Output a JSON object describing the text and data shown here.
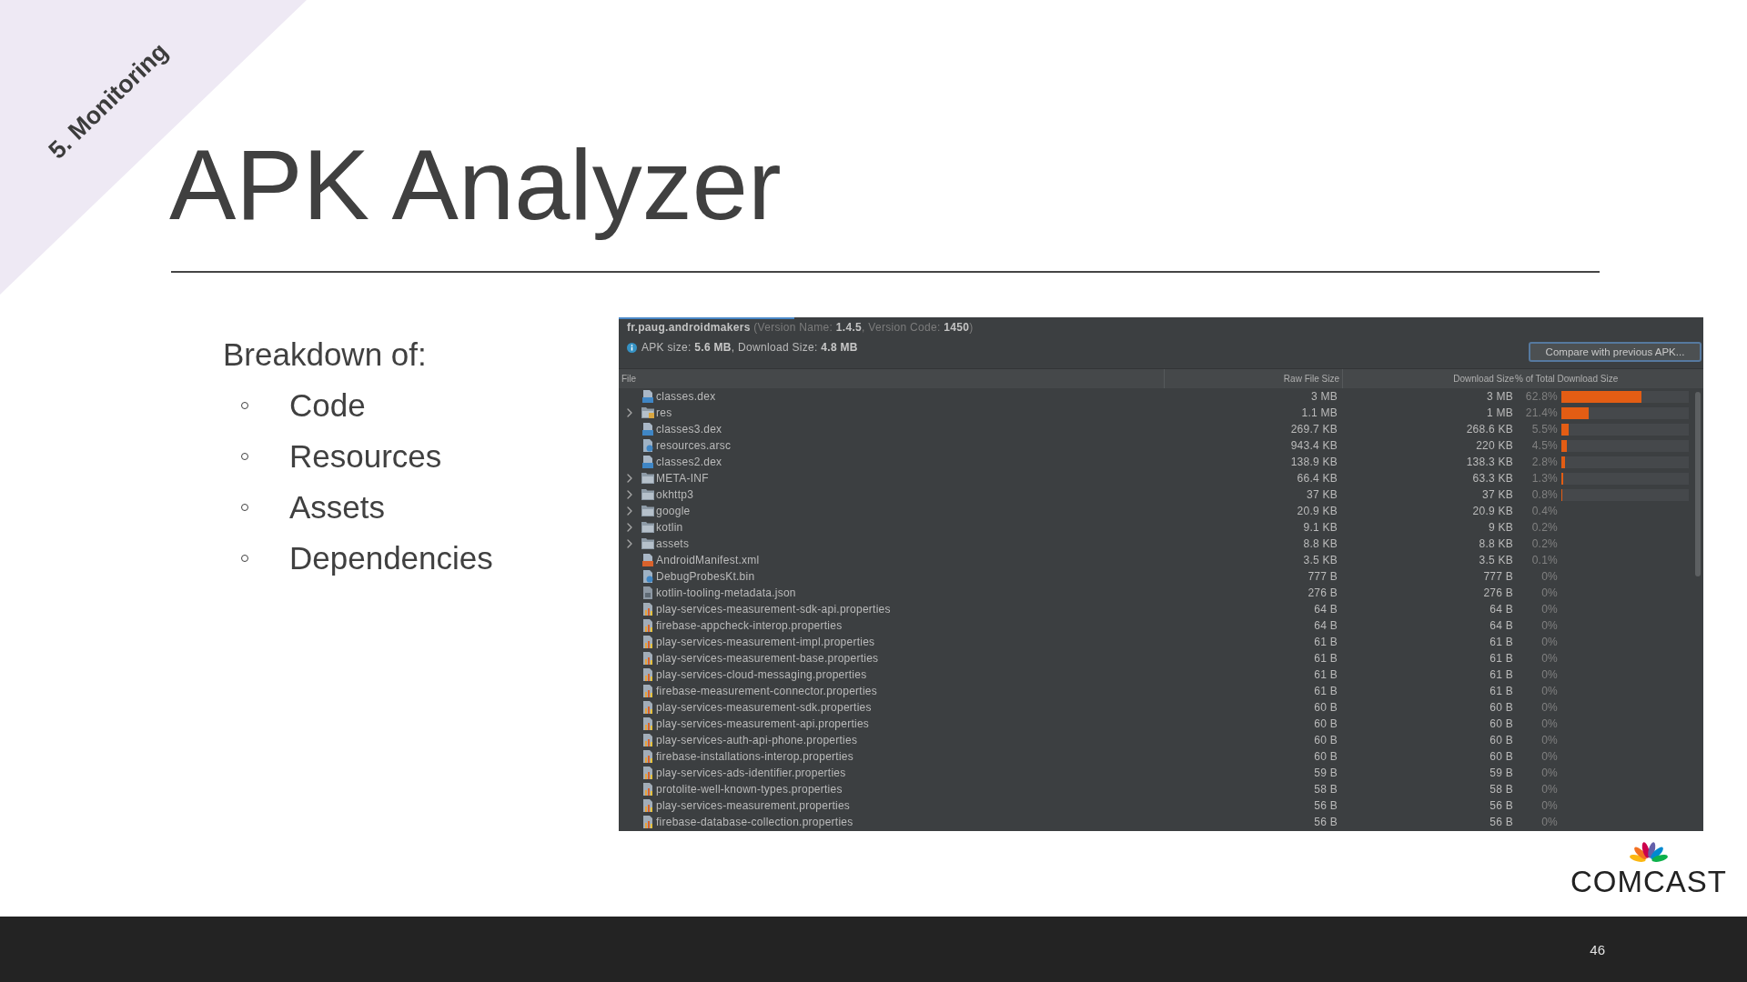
{
  "slide": {
    "section": "5. Monitoring",
    "title": "APK Analyzer",
    "logo_text": "COMCAST",
    "page_number": "46"
  },
  "bullets": {
    "intro": "Breakdown of:",
    "items": [
      "Code",
      "Resources",
      "Assets",
      "Dependencies"
    ]
  },
  "apk_analyzer": {
    "app_line": "**fr.paug.androidmakers** (Version Name: **1.4.5**, Version Code: **1450**)",
    "size_line": "APK size: **5.6 MB**, Download Size: **4.8 MB**",
    "compare_button": {
      "label": "Compare with previous APK...",
      "focused": true
    },
    "columns": [
      "File",
      "Raw File Size",
      "Download Size",
      "% of Total Download Size"
    ],
    "rows": [
      {
        "kind": "dex",
        "name": "classes.dex",
        "expandable": false,
        "raw_size": "3 MB",
        "download_size": "3 MB",
        "percent": "62.8%",
        "level": 0.628
      },
      {
        "kind": "res_folder",
        "name": "res",
        "expandable": true,
        "raw_size": "1.1 MB",
        "download_size": "1 MB",
        "percent": "21.4%",
        "level": 0.214
      },
      {
        "kind": "dex",
        "name": "classes3.dex",
        "expandable": false,
        "raw_size": "269.7 KB",
        "download_size": "268.6 KB",
        "percent": "5.5%",
        "level": 0.055
      },
      {
        "kind": "unknown",
        "name": "resources.arsc",
        "expandable": false,
        "raw_size": "943.4 KB",
        "download_size": "220 KB",
        "percent": "4.5%",
        "level": 0.045
      },
      {
        "kind": "dex",
        "name": "classes2.dex",
        "expandable": false,
        "raw_size": "138.9 KB",
        "download_size": "138.3 KB",
        "percent": "2.8%",
        "level": 0.028
      },
      {
        "kind": "folder",
        "name": "META-INF",
        "expandable": true,
        "raw_size": "66.4 KB",
        "download_size": "63.3 KB",
        "percent": "1.3%",
        "level": 0.013
      },
      {
        "kind": "folder",
        "name": "okhttp3",
        "expandable": true,
        "raw_size": "37 KB",
        "download_size": "37 KB",
        "percent": "0.8%",
        "level": 0.008
      },
      {
        "kind": "folder",
        "name": "google",
        "expandable": true,
        "raw_size": "20.9 KB",
        "download_size": "20.9 KB",
        "percent": "0.4%"
      },
      {
        "kind": "folder",
        "name": "kotlin",
        "expandable": true,
        "raw_size": "9.1 KB",
        "download_size": "9 KB",
        "percent": "0.2%"
      },
      {
        "kind": "folder",
        "name": "assets",
        "expandable": true,
        "raw_size": "8.8 KB",
        "download_size": "8.8 KB",
        "percent": "0.2%"
      },
      {
        "kind": "xml",
        "name": "AndroidManifest.xml",
        "expandable": false,
        "raw_size": "3.5 KB",
        "download_size": "3.5 KB",
        "percent": "0.1%"
      },
      {
        "kind": "unknown",
        "name": "DebugProbesKt.bin",
        "expandable": false,
        "raw_size": "777 B",
        "download_size": "777 B",
        "percent": "0%"
      },
      {
        "kind": "json",
        "name": "kotlin-tooling-metadata.json",
        "expandable": false,
        "raw_size": "276 B",
        "download_size": "276 B",
        "percent": "0%"
      },
      {
        "kind": "properties",
        "name": "play-services-measurement-sdk-api.properties",
        "expandable": false,
        "raw_size": "64 B",
        "download_size": "64 B",
        "percent": "0%"
      },
      {
        "kind": "properties",
        "name": "firebase-appcheck-interop.properties",
        "expandable": false,
        "raw_size": "64 B",
        "download_size": "64 B",
        "percent": "0%"
      },
      {
        "kind": "properties",
        "name": "play-services-measurement-impl.properties",
        "expandable": false,
        "raw_size": "61 B",
        "download_size": "61 B",
        "percent": "0%"
      },
      {
        "kind": "properties",
        "name": "play-services-measurement-base.properties",
        "expandable": false,
        "raw_size": "61 B",
        "download_size": "61 B",
        "percent": "0%"
      },
      {
        "kind": "properties",
        "name": "play-services-cloud-messaging.properties",
        "expandable": false,
        "raw_size": "61 B",
        "download_size": "61 B",
        "percent": "0%"
      },
      {
        "kind": "properties",
        "name": "firebase-measurement-connector.properties",
        "expandable": false,
        "raw_size": "61 B",
        "download_size": "61 B",
        "percent": "0%"
      },
      {
        "kind": "properties",
        "name": "play-services-measurement-sdk.properties",
        "expandable": false,
        "raw_size": "60 B",
        "download_size": "60 B",
        "percent": "0%"
      },
      {
        "kind": "properties",
        "name": "play-services-measurement-api.properties",
        "expandable": false,
        "raw_size": "60 B",
        "download_size": "60 B",
        "percent": "0%"
      },
      {
        "kind": "properties",
        "name": "play-services-auth-api-phone.properties",
        "expandable": false,
        "raw_size": "60 B",
        "download_size": "60 B",
        "percent": "0%"
      },
      {
        "kind": "properties",
        "name": "firebase-installations-interop.properties",
        "expandable": false,
        "raw_size": "60 B",
        "download_size": "60 B",
        "percent": "0%"
      },
      {
        "kind": "properties",
        "name": "play-services-ads-identifier.properties",
        "expandable": false,
        "raw_size": "59 B",
        "download_size": "59 B",
        "percent": "0%"
      },
      {
        "kind": "properties",
        "name": "protolite-well-known-types.properties",
        "expandable": false,
        "raw_size": "58 B",
        "download_size": "58 B",
        "percent": "0%"
      },
      {
        "kind": "properties",
        "name": "play-services-measurement.properties",
        "expandable": false,
        "raw_size": "56 B",
        "download_size": "56 B",
        "percent": "0%"
      },
      {
        "kind": "properties",
        "name": "firebase-database-collection.properties",
        "expandable": false,
        "raw_size": "56 B",
        "download_size": "56 B",
        "percent": "0%"
      }
    ]
  }
}
